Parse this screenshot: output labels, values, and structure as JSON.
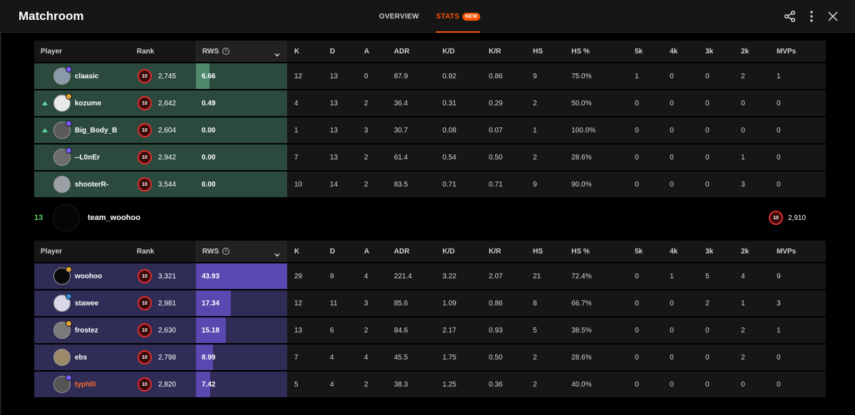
{
  "header": {
    "title": "Matchroom",
    "tabs": [
      {
        "label": "OVERVIEW",
        "active": false
      },
      {
        "label": "STATS",
        "active": true,
        "badge": "NEW"
      }
    ],
    "icons": [
      "share-icon",
      "more-vertical-icon",
      "close-icon"
    ]
  },
  "columns": {
    "player": "Player",
    "rank": "Rank",
    "rws": "RWS",
    "k": "K",
    "d": "D",
    "a": "A",
    "adr": "ADR",
    "kd": "K/D",
    "kr": "K/R",
    "hs": "HS",
    "hsp": "HS %",
    "k5": "5k",
    "k4": "4k",
    "k3": "3k",
    "k2": "2k",
    "mvps": "MVPs"
  },
  "team1": {
    "color": "#2b4a3d",
    "players": [
      {
        "name": "claasic",
        "level": "10",
        "elo": "2,745",
        "rws": "6.66",
        "rws_fraction": 0.15,
        "arrow": false,
        "dot": "#7b5cff",
        "avatar": "#8a9aa8",
        "k": "12",
        "d": "13",
        "a": "0",
        "adr": "87.9",
        "kd": "0.92",
        "kr": "0.86",
        "hs": "9",
        "hsp": "75.0%",
        "k5": "1",
        "k4": "0",
        "k3": "0",
        "k2": "2",
        "mvps": "1"
      },
      {
        "name": "kozume",
        "level": "10",
        "elo": "2,642",
        "rws": "0.49",
        "rws_fraction": 0.0,
        "arrow": true,
        "dot": "#e0a33a",
        "avatar": "#e8e8e8",
        "k": "4",
        "d": "13",
        "a": "2",
        "adr": "36.4",
        "kd": "0.31",
        "kr": "0.29",
        "hs": "2",
        "hsp": "50.0%",
        "k5": "0",
        "k4": "0",
        "k3": "0",
        "k2": "0",
        "mvps": "0"
      },
      {
        "name": "Big_Body_B",
        "level": "10",
        "elo": "2,604",
        "rws": "0.00",
        "rws_fraction": 0.0,
        "arrow": true,
        "dot": "#7b5cff",
        "avatar": "#5a5a5a",
        "k": "1",
        "d": "13",
        "a": "3",
        "adr": "30.7",
        "kd": "0.08",
        "kr": "0.07",
        "hs": "1",
        "hsp": "100.0%",
        "k5": "0",
        "k4": "0",
        "k3": "0",
        "k2": "0",
        "mvps": "0"
      },
      {
        "name": "--L0nEr",
        "level": "10",
        "elo": "2,942",
        "rws": "0.00",
        "rws_fraction": 0.0,
        "arrow": false,
        "dot": "#7b5cff",
        "avatar": "#6c6c6c",
        "k": "7",
        "d": "13",
        "a": "2",
        "adr": "61.4",
        "kd": "0.54",
        "kr": "0.50",
        "hs": "2",
        "hsp": "28.6%",
        "k5": "0",
        "k4": "0",
        "k3": "0",
        "k2": "1",
        "mvps": "0"
      },
      {
        "name": "shooterR-",
        "level": "10",
        "elo": "3,544",
        "rws": "0.00",
        "rws_fraction": 0.0,
        "arrow": false,
        "dot": "",
        "avatar": "#9aa0a6",
        "k": "10",
        "d": "14",
        "a": "2",
        "adr": "83.5",
        "kd": "0.71",
        "kr": "0.71",
        "hs": "9",
        "hsp": "90.0%",
        "k5": "0",
        "k4": "0",
        "k3": "0",
        "k2": "3",
        "mvps": "0"
      }
    ]
  },
  "team2_banner": {
    "score": "13",
    "name": "team_woohoo",
    "level": "10",
    "elo": "2,910"
  },
  "team2": {
    "color": "#2f2c55",
    "players": [
      {
        "name": "woohoo",
        "level": "10",
        "elo": "3,321",
        "rws": "43.93",
        "rws_fraction": 1.0,
        "arrow": false,
        "dot": "#e0a33a",
        "avatar": "#0a0a0a",
        "orange": false,
        "k": "29",
        "d": "9",
        "a": "4",
        "adr": "221.4",
        "kd": "3.22",
        "kr": "2.07",
        "hs": "21",
        "hsp": "72.4%",
        "k5": "0",
        "k4": "1",
        "k3": "5",
        "k2": "4",
        "mvps": "9"
      },
      {
        "name": "stawee",
        "level": "10",
        "elo": "2,981",
        "rws": "17.34",
        "rws_fraction": 0.38,
        "arrow": false,
        "dot": "#3a8ee0",
        "avatar": "#d8d8e8",
        "orange": false,
        "k": "12",
        "d": "11",
        "a": "3",
        "adr": "85.6",
        "kd": "1.09",
        "kr": "0.86",
        "hs": "8",
        "hsp": "66.7%",
        "k5": "0",
        "k4": "0",
        "k3": "2",
        "k2": "1",
        "mvps": "3"
      },
      {
        "name": "frostez",
        "level": "10",
        "elo": "2,630",
        "rws": "15.18",
        "rws_fraction": 0.33,
        "arrow": false,
        "dot": "#e0a33a",
        "avatar": "#7a7a7a",
        "orange": false,
        "k": "13",
        "d": "6",
        "a": "2",
        "adr": "84.6",
        "kd": "2.17",
        "kr": "0.93",
        "hs": "5",
        "hsp": "38.5%",
        "k5": "0",
        "k4": "0",
        "k3": "0",
        "k2": "2",
        "mvps": "1"
      },
      {
        "name": "ebs",
        "level": "10",
        "elo": "2,798",
        "rws": "8.99",
        "rws_fraction": 0.19,
        "arrow": false,
        "dot": "",
        "avatar": "#9c8a6a",
        "orange": false,
        "k": "7",
        "d": "4",
        "a": "4",
        "adr": "45.5",
        "kd": "1.75",
        "kr": "0.50",
        "hs": "2",
        "hsp": "28.6%",
        "k5": "0",
        "k4": "0",
        "k3": "0",
        "k2": "2",
        "mvps": "0"
      },
      {
        "name": "typhl0",
        "level": "10",
        "elo": "2,820",
        "rws": "7.42",
        "rws_fraction": 0.16,
        "arrow": false,
        "dot": "#7b5cff",
        "avatar": "#555555",
        "orange": true,
        "k": "5",
        "d": "4",
        "a": "2",
        "adr": "38.3",
        "kd": "1.25",
        "kr": "0.36",
        "hs": "2",
        "hsp": "40.0%",
        "k5": "0",
        "k4": "0",
        "k3": "0",
        "k2": "0",
        "mvps": "0"
      }
    ]
  }
}
